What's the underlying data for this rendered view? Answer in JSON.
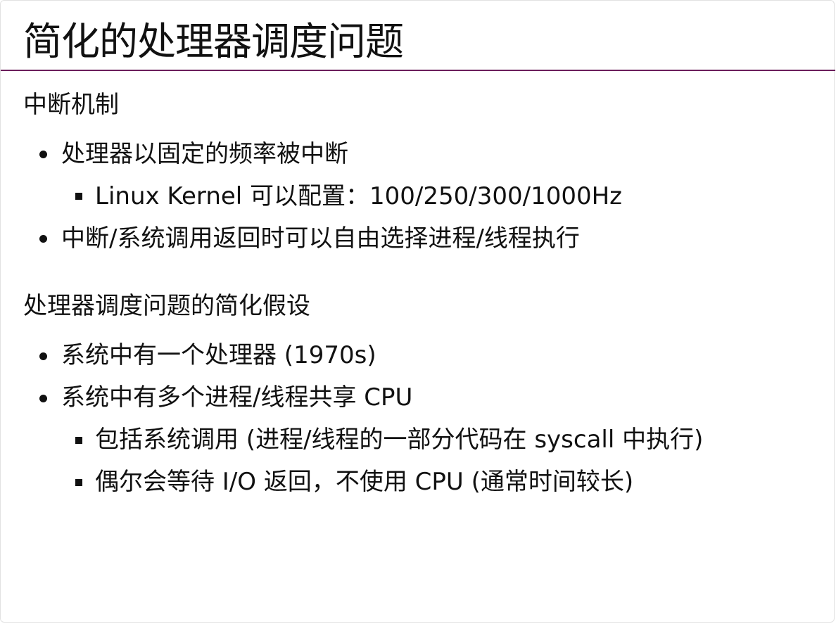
{
  "slide": {
    "title": "简化的处理器调度问题",
    "accent_color": "#6b1e5c",
    "sections": [
      {
        "heading": "中断机制",
        "items": [
          {
            "text": "处理器以固定的频率被中断",
            "level": 1
          },
          {
            "text": "Linux Kernel 可以配置：100/250/300/1000Hz",
            "level": 2
          },
          {
            "text": "中断/系统调用返回时可以自由选择进程/线程执行",
            "level": 1
          }
        ]
      },
      {
        "heading": "处理器调度问题的简化假设",
        "items": [
          {
            "text": "系统中有一个处理器 (1970s)",
            "level": 1
          },
          {
            "text": "系统中有多个进程/线程共享 CPU",
            "level": 1
          },
          {
            "text": "包括系统调用 (进程/线程的一部分代码在 syscall 中执行)",
            "level": 2
          },
          {
            "text": "偶尔会等待 I/O 返回，不使用 CPU (通常时间较长)",
            "level": 2
          }
        ]
      }
    ]
  }
}
